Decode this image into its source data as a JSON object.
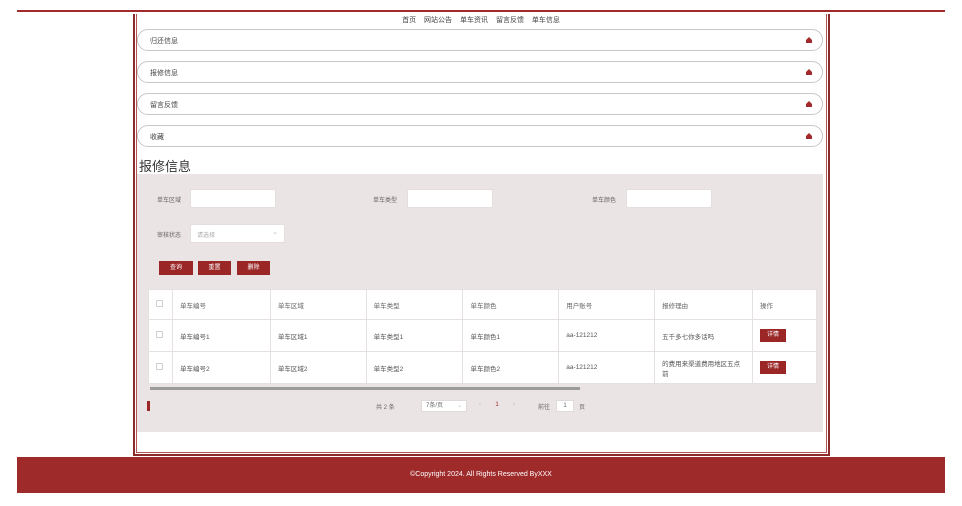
{
  "nav": [
    "首页",
    "网站公告",
    "单车资讯",
    "留言反馈",
    "单车信息"
  ],
  "accordion": [
    "归还信息",
    "报修信息",
    "留言反馈",
    "收藏"
  ],
  "page_title": "报修信息",
  "filters": {
    "area_label": "单车区域",
    "type_label": "单车类型",
    "color_label": "单车颜色",
    "status_label": "审核状态",
    "status_placeholder": "请选择"
  },
  "buttons": {
    "query": "查询",
    "reset": "重置",
    "delete": "删除"
  },
  "table": {
    "headers": [
      "单车编号",
      "单车区域",
      "单车类型",
      "单车颜色",
      "用户账号",
      "报修理由",
      "操作"
    ],
    "rows": [
      {
        "no": "单车编号1",
        "area": "单车区域1",
        "type": "单车类型1",
        "color": "单车颜色1",
        "user": "aa-121212",
        "reason": "五千多七你多话吗",
        "action": "详情"
      },
      {
        "no": "单车编号2",
        "area": "单车区域2",
        "type": "单车类型2",
        "color": "单车颜色2",
        "user": "aa-121212",
        "reason": "的费用来渠道费用地区五点前",
        "action": "详情"
      }
    ]
  },
  "pagination": {
    "total": "共 2 条",
    "per_page": "7条/页",
    "current": "1",
    "goto_label": "前往",
    "goto_value": "1",
    "page_suffix": "页"
  },
  "footer": "©Copyright 2024. All Rights Reserved ByXXX",
  "colors": {
    "accent": "#9e2a2a",
    "panel": "#ebe4e4"
  }
}
